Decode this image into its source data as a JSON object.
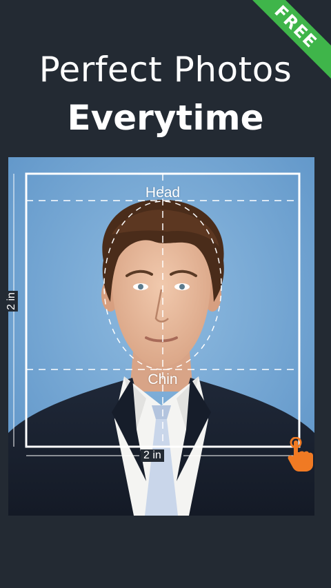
{
  "promo": {
    "ribbon_text": "FREE",
    "headline_line1": "Perfect Photos",
    "headline_line2": "Everytime"
  },
  "crop_frame": {
    "top_guide_label": "Head",
    "bottom_guide_label": "Chin",
    "width_label": "2 in",
    "height_label": "2 in"
  },
  "colors": {
    "background": "#232a33",
    "ribbon": "#3fb54a",
    "photo_backdrop": "#6da0cf",
    "handle": "#f07a23"
  },
  "icons": {
    "resize_handle": "hand-pointer-icon"
  }
}
